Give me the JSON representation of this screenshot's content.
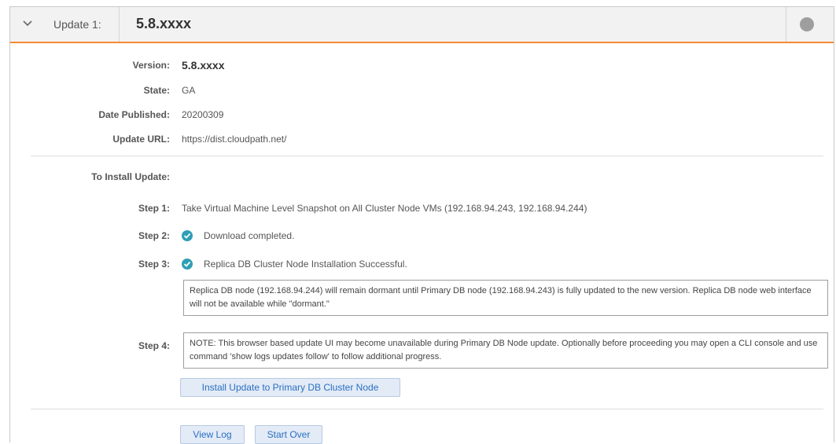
{
  "header": {
    "update_label": "Update 1:",
    "update_value": "5.8.xxxx",
    "chevron_icon": "chevron-down-icon",
    "status_icon": "status-dot-icon",
    "accent_color": "#f28b30",
    "status_color": "#9e9e9e"
  },
  "details": {
    "version_label": "Version:",
    "version_value": "5.8.xxxx",
    "state_label": "State:",
    "state_value": "GA",
    "date_label": "Date Published:",
    "date_value": "20200309",
    "url_label": "Update URL:",
    "url_value": "https://dist.cloudpath.net/"
  },
  "install": {
    "heading": "To Install Update:",
    "step1_label": "Step 1:",
    "step1_text": "Take Virtual Machine Level Snapshot on All Cluster Node VMs (192.168.94.243, 192.168.94.244)",
    "step2_label": "Step 2:",
    "step2_text": "Download completed.",
    "step3_label": "Step 3:",
    "step3_text": "Replica DB Cluster Node Installation Successful.",
    "step3_note": "Replica DB node (192.168.94.244) will remain dormant until Primary DB node (192.168.94.243) is fully updated to the new version. Replica DB node web interface will not be available while \"dormant.\"",
    "step4_label": "Step 4:",
    "step4_note": "NOTE: This browser based update UI may become unavailable during Primary DB Node update. Optionally before proceeding you may open a CLI console and use command 'show logs updates follow' to follow additional progress.",
    "install_button": "Install Update to Primary DB Cluster Node",
    "check_icon": "check-circle-icon",
    "check_color": "#2f9fb5"
  },
  "footer": {
    "view_log_button": "View Log",
    "start_over_button": "Start Over"
  }
}
